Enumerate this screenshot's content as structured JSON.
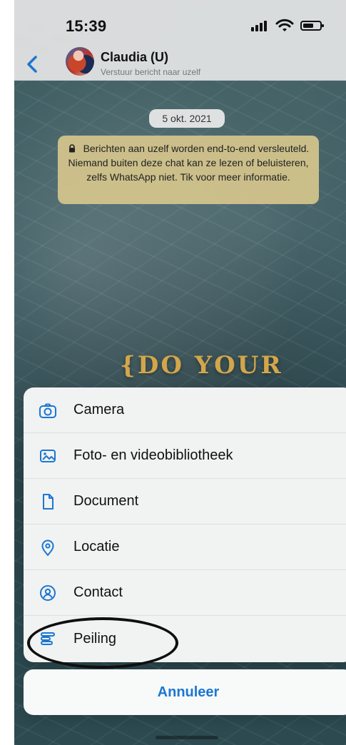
{
  "status": {
    "time": "15:39"
  },
  "header": {
    "contact_name": "Claudia (U)",
    "contact_subtitle": "Verstuur bericht naar uzelf"
  },
  "chat": {
    "date_label": "5 okt. 2021",
    "encryption_notice": "Berichten aan uzelf worden end-to-end versleuteld. Niemand buiten deze chat kan ze lezen of beluisteren, zelfs WhatsApp niet. Tik voor meer informatie.",
    "wallpaper_text": "{DO YOUR"
  },
  "action_sheet": {
    "items": [
      {
        "label": "Camera",
        "icon": "camera-icon"
      },
      {
        "label": "Foto- en videobibliotheek",
        "icon": "photo-library-icon"
      },
      {
        "label": "Document",
        "icon": "document-icon"
      },
      {
        "label": "Locatie",
        "icon": "location-icon"
      },
      {
        "label": "Contact",
        "icon": "contact-icon"
      },
      {
        "label": "Peiling",
        "icon": "poll-icon"
      }
    ],
    "cancel_label": "Annuleer"
  },
  "colors": {
    "accent": "#1b77d1",
    "notice_bg": "#d6c68c"
  }
}
